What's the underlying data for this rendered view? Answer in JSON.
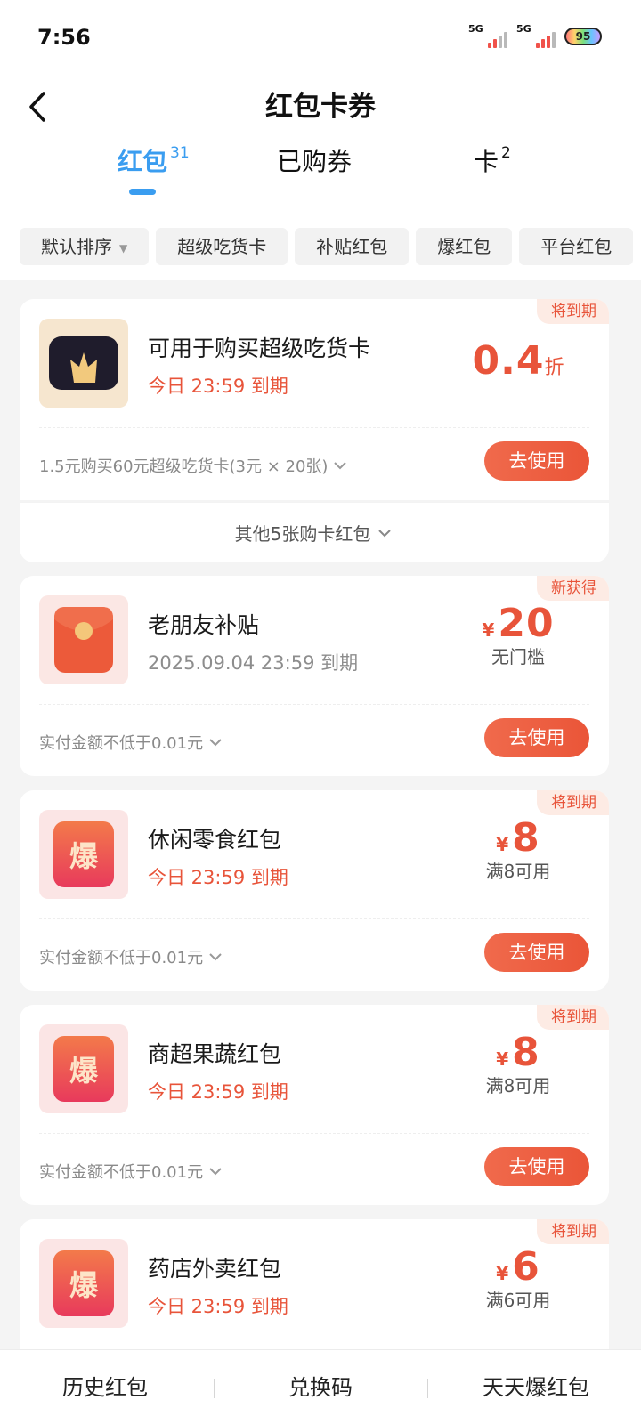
{
  "status": {
    "time": "7:56",
    "sim1": "5G",
    "sim2": "5G",
    "battery": "95"
  },
  "nav": {
    "title": "红包卡券"
  },
  "tabs": [
    {
      "label": "红包",
      "count": "31",
      "active": true
    },
    {
      "label": "已购券",
      "count": "",
      "active": false
    },
    {
      "label": "卡",
      "count": "2",
      "active": false
    }
  ],
  "filters": [
    "默认排序",
    "超级吃货卡",
    "补贴红包",
    "爆红包",
    "平台红包"
  ],
  "cards": [
    {
      "badge": "将到期",
      "icon": "crown-icon",
      "title": "可用于购买超级吃货卡",
      "subtitle": "今日 23:59 到期",
      "amount_value": "0.4",
      "amount_unit": "折",
      "condition": "",
      "footer": "1.5元购买60元超级吃货卡(3元 × 20张)",
      "button": "去使用"
    },
    {
      "badge": "新获得",
      "icon": "red-envelope-icon",
      "title": "老朋友补贴",
      "subtitle": "2025.09.04 23:59 到期",
      "amount_currency": "¥",
      "amount_value": "20",
      "condition": "无门槛",
      "footer": "实付金额不低于0.01元",
      "button": "去使用"
    },
    {
      "badge": "将到期",
      "icon": "bao-icon",
      "title": "休闲零食红包",
      "subtitle": "今日 23:59 到期",
      "amount_currency": "¥",
      "amount_value": "8",
      "condition": "满8可用",
      "footer": "实付金额不低于0.01元",
      "button": "去使用"
    },
    {
      "badge": "将到期",
      "icon": "bao-icon",
      "title": "商超果蔬红包",
      "subtitle": "今日 23:59 到期",
      "amount_currency": "¥",
      "amount_value": "8",
      "condition": "满8可用",
      "footer": "实付金额不低于0.01元",
      "button": "去使用"
    },
    {
      "badge": "将到期",
      "icon": "bao-icon",
      "title": "药店外卖红包",
      "subtitle": "今日 23:59 到期",
      "amount_currency": "¥",
      "amount_value": "6",
      "condition": "满6可用",
      "footer": "",
      "button": ""
    }
  ],
  "expand": {
    "label": "其他5张购卡红包"
  },
  "bao_char": "爆",
  "bottom": [
    "历史红包",
    "兑换码",
    "天天爆红包"
  ],
  "colors": {
    "accent_blue": "#3a9df0",
    "accent_red": "#e8543a",
    "button_gradient_start": "#f06a4c",
    "button_gradient_end": "#ea5538"
  }
}
